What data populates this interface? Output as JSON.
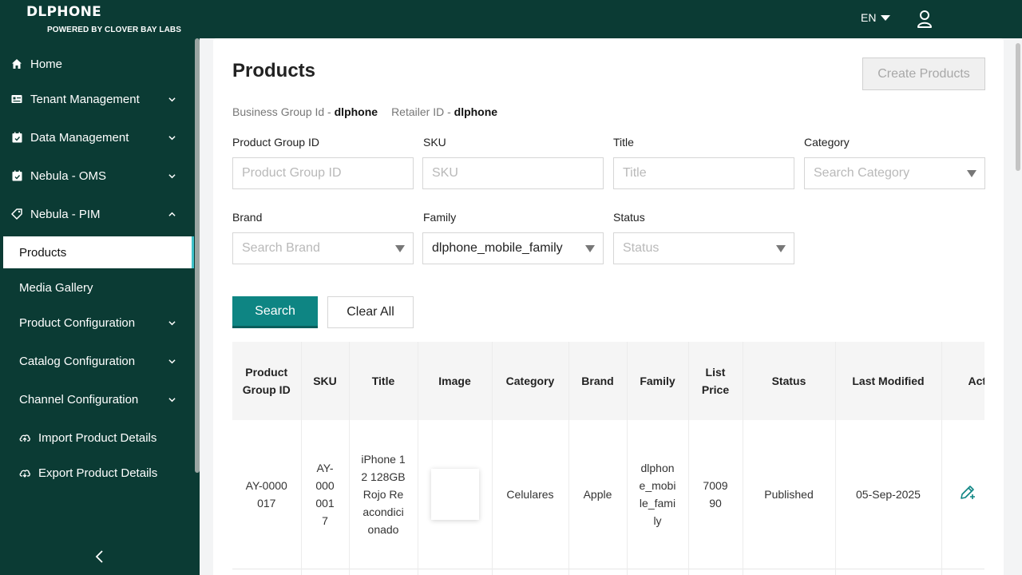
{
  "topbar": {
    "brand": "DLPHONE",
    "powered_by": "POWERED BY CLOVER BAY LABS",
    "language": "EN",
    "lang_caret_icon": "caret-down-icon",
    "user_icon": "user-icon"
  },
  "sidebar": {
    "items": [
      {
        "label": "Home",
        "icon": "home-icon"
      },
      {
        "label": "Tenant Management",
        "icon": "id-card-icon"
      },
      {
        "label": "Data Management",
        "icon": "calendar-icon"
      },
      {
        "label": "Nebula - OMS",
        "icon": "calendar-icon"
      },
      {
        "label": "Nebula - PIM",
        "icon": "tag-icon"
      },
      {
        "label": "Products"
      },
      {
        "label": "Media Gallery"
      },
      {
        "label": "Product Configuration"
      },
      {
        "label": "Catalog Configuration"
      },
      {
        "label": "Channel Configuration"
      },
      {
        "label": "Import Product Details",
        "icon": "cloud-upload-icon"
      },
      {
        "label": "Export Product Details",
        "icon": "cloud-download-icon"
      }
    ]
  },
  "page": {
    "title": "Products",
    "create_button": "Create Products",
    "business_group_label": "Business Group Id -",
    "business_group_value": "dlphone",
    "retailer_label": "Retailer ID -",
    "retailer_value": "dlphone"
  },
  "filters": {
    "product_group_id": {
      "label": "Product Group ID",
      "placeholder": "Product Group ID"
    },
    "sku": {
      "label": "SKU",
      "placeholder": "SKU"
    },
    "title": {
      "label": "Title",
      "placeholder": "Title"
    },
    "category": {
      "label": "Category",
      "placeholder": "Search Category"
    },
    "brand": {
      "label": "Brand",
      "placeholder": "Search Brand"
    },
    "family": {
      "label": "Family",
      "value": "dlphone_mobile_family"
    },
    "status": {
      "label": "Status",
      "placeholder": "Status"
    },
    "search_button": "Search",
    "clear_button": "Clear All"
  },
  "table": {
    "columns": [
      "Product Group ID",
      "SKU",
      "Title",
      "Image",
      "Category",
      "Brand",
      "Family",
      "List Price",
      "Status",
      "Last Modified",
      "Actions"
    ],
    "rows": [
      {
        "product_group_id": "AY-0000017",
        "sku": "AY-0000017",
        "title": "iPhone 12 128GB Rojo Reacondicionado",
        "category": "Celulares",
        "brand": "Apple",
        "family": "dlphone_mobile_family",
        "list_price": "700990",
        "status": "Published",
        "last_modified": "05-Sep-2025"
      }
    ]
  },
  "colors": {
    "sidebar_bg": "#0b3b34",
    "primary_button": "#0e8583",
    "active_indicator": "#3fc1c9"
  }
}
